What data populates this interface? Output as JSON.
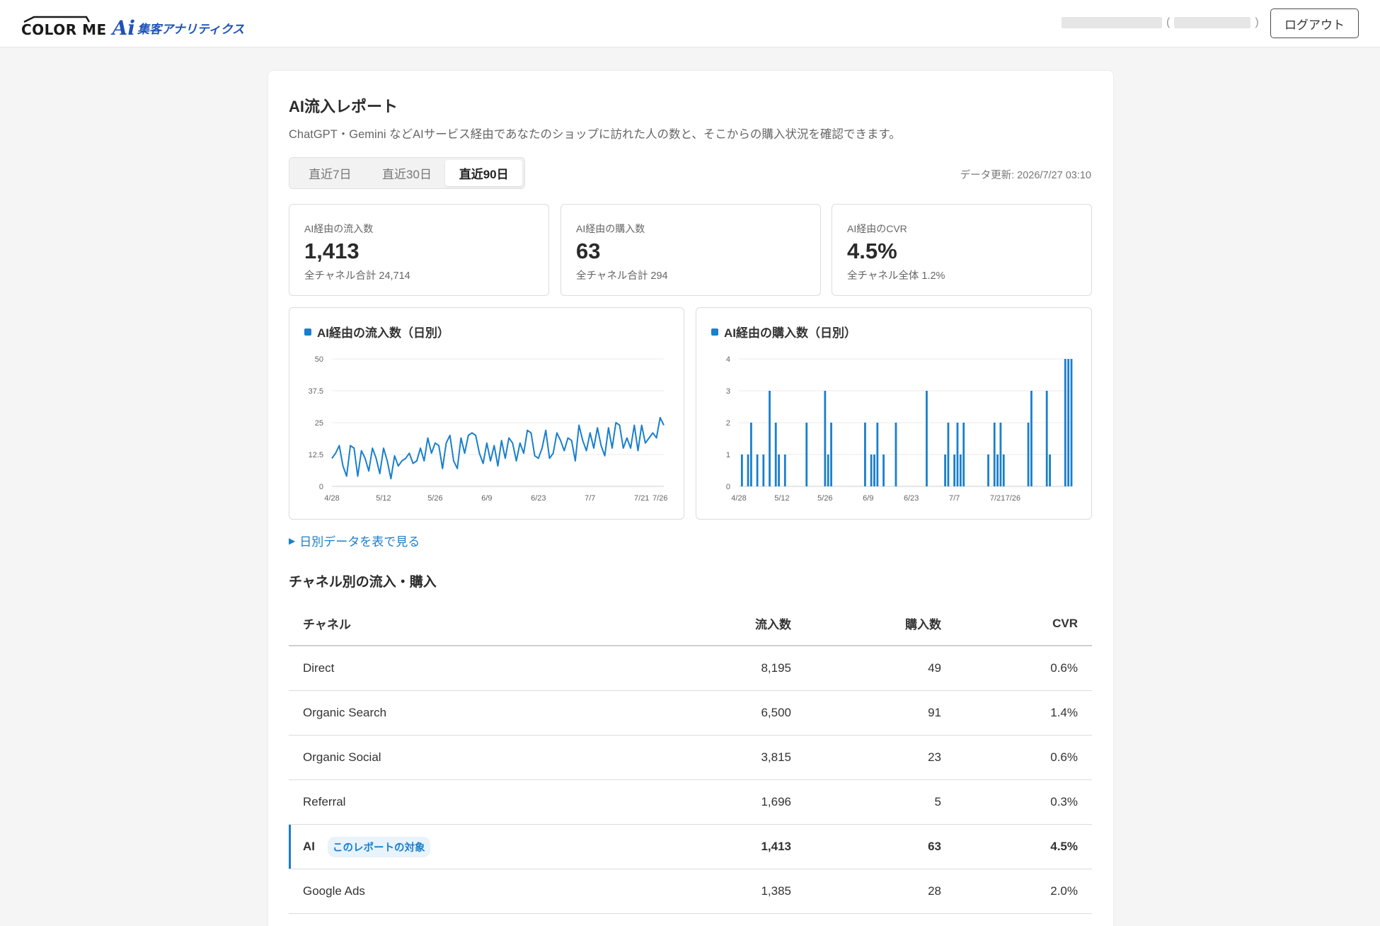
{
  "header": {
    "brand": "COLOR ME",
    "brand_ai": "Ai",
    "brand_sub": "集客アナリティクス",
    "user_paren_open": "(",
    "user_paren_close": ")",
    "logout_label": "ログアウト"
  },
  "page": {
    "title": "AI流入レポート",
    "description": "ChatGPT・Gemini などAIサービス経由であなたのショップに訪れた人の数と、そこからの購入状況を確認できます。",
    "updated": "データ更新: 2026/7/27 03:10"
  },
  "periods": [
    {
      "label": "直近7日",
      "active": false
    },
    {
      "label": "直近30日",
      "active": false
    },
    {
      "label": "直近90日",
      "active": true
    }
  ],
  "kpis": [
    {
      "label": "AI経由の流入数",
      "value": "1,413",
      "sub": "全チャネル合計 24,714"
    },
    {
      "label": "AI経由の購入数",
      "value": "63",
      "sub": "全チャネル合計 294"
    },
    {
      "label": "AI経由のCVR",
      "value": "4.5%",
      "sub": "全チャネル全体 1.2%"
    }
  ],
  "chart_data": [
    {
      "type": "line",
      "title": "AI経由の流入数（日別）",
      "ylim": [
        0,
        50
      ],
      "yticks": [
        "0",
        "12.5",
        "25",
        "37.5",
        "50"
      ],
      "xtick_labels": [
        "4/28",
        "5/12",
        "5/26",
        "6/9",
        "6/23",
        "7/7",
        "7/21",
        "7/26"
      ],
      "xtick_index": [
        0,
        14,
        28,
        42,
        56,
        70,
        84,
        89
      ],
      "color": "#1a7fcc",
      "grid": true,
      "values": [
        11,
        13,
        16,
        8,
        4,
        16,
        15,
        4,
        14,
        11,
        6,
        15,
        11,
        5,
        15,
        10,
        3,
        12,
        8,
        10,
        11,
        13,
        9,
        10,
        15,
        10,
        19,
        13,
        17,
        16,
        7,
        17,
        20,
        10,
        7,
        19,
        13,
        20,
        21,
        20,
        13,
        9,
        17,
        10,
        16,
        8,
        18,
        11,
        19,
        17,
        10,
        17,
        13,
        22,
        21,
        12,
        11,
        15,
        22,
        11,
        13,
        21,
        18,
        14,
        19,
        18,
        10,
        24,
        18,
        14,
        21,
        15,
        23,
        16,
        12,
        23,
        15,
        25,
        24,
        15,
        19,
        15,
        24,
        14,
        24,
        17,
        19,
        21,
        19,
        27,
        24
      ]
    },
    {
      "type": "bar",
      "title": "AI経由の購入数（日別）",
      "ylim": [
        0,
        4
      ],
      "yticks": [
        "0",
        "1",
        "2",
        "3",
        "4"
      ],
      "xtick_labels": [
        "4/28",
        "5/12",
        "5/26",
        "6/9",
        "6/23",
        "7/7",
        "7/21",
        "7/26"
      ],
      "xtick_index": [
        0,
        14,
        28,
        42,
        56,
        70,
        84,
        89
      ],
      "color": "#1a7fcc",
      "grid": true,
      "values": [
        0,
        1,
        0,
        1,
        2,
        0,
        1,
        0,
        1,
        0,
        3,
        0,
        2,
        1,
        0,
        1,
        0,
        0,
        0,
        0,
        0,
        0,
        2,
        0,
        0,
        0,
        0,
        0,
        3,
        1,
        2,
        0,
        0,
        0,
        0,
        0,
        0,
        0,
        0,
        0,
        0,
        2,
        0,
        1,
        1,
        2,
        0,
        1,
        0,
        0,
        0,
        2,
        0,
        0,
        0,
        0,
        0,
        0,
        0,
        0,
        0,
        3,
        0,
        0,
        0,
        0,
        0,
        1,
        2,
        0,
        1,
        2,
        1,
        2,
        0,
        0,
        0,
        0,
        0,
        0,
        0,
        1,
        0,
        2,
        1,
        2,
        1,
        0,
        0,
        0,
        0,
        0,
        0,
        0,
        2,
        3,
        0,
        0,
        0,
        0,
        3,
        1,
        0,
        0,
        0,
        0,
        4,
        4,
        4
      ]
    }
  ],
  "toggle_label": "日別データを表で見る",
  "channels": {
    "title": "チャネル別の流入・購入",
    "headers": {
      "channel": "チャネル",
      "inflow": "流入数",
      "purchases": "購入数",
      "cvr": "CVR"
    },
    "rows": [
      {
        "channel": "Direct",
        "inflow": "8,195",
        "purchases": "49",
        "cvr": "0.6%"
      },
      {
        "channel": "Organic Search",
        "inflow": "6,500",
        "purchases": "91",
        "cvr": "1.4%"
      },
      {
        "channel": "Organic Social",
        "inflow": "3,815",
        "purchases": "23",
        "cvr": "0.6%"
      },
      {
        "channel": "Referral",
        "inflow": "1,696",
        "purchases": "5",
        "cvr": "0.3%"
      },
      {
        "channel": "AI",
        "inflow": "1,413",
        "purchases": "63",
        "cvr": "4.5%",
        "badge": "このレポートの対象"
      },
      {
        "channel": "Google Ads",
        "inflow": "1,385",
        "purchases": "28",
        "cvr": "2.0%"
      }
    ]
  }
}
